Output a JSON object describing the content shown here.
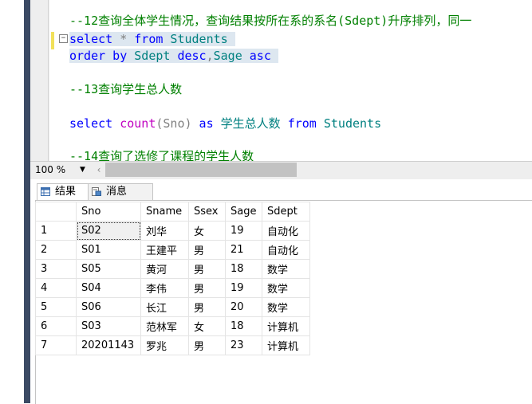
{
  "editor": {
    "line1": "--12查询全体学生情况，查询结果按所在系的系名(Sdept)升序排列，同一",
    "line2_kw1": "select",
    "line2_star": " * ",
    "line2_kw2": "from",
    "line2_id": " Students",
    "line3_kw1": "order by",
    "line3_id": " Sdept ",
    "line3_kw2": "desc",
    "line3_comma": ",",
    "line3_id2": "Sage",
    "line3_kw3": " asc",
    "line4": "--13查询学生总人数",
    "line5_kw1": "select",
    "line5_fn": " count",
    "line5_paren": "(Sno)",
    "line5_kw2": " as",
    "line5_alias": " 学生总人数",
    "line5_kw3": " from",
    "line5_id": " Students",
    "line6": "--14查询了选修了课程的学生人数"
  },
  "zoom": {
    "value": "100 %"
  },
  "tabs": {
    "results": "结果",
    "messages": "消息"
  },
  "grid": {
    "headers": [
      "",
      "Sno",
      "Sname",
      "Ssex",
      "Sage",
      "Sdept"
    ],
    "rows": [
      [
        "1",
        "S02",
        "刘华",
        "女",
        "19",
        "自动化"
      ],
      [
        "2",
        "S01",
        "王建平",
        "男",
        "21",
        "自动化"
      ],
      [
        "3",
        "S05",
        "黄河",
        "男",
        "18",
        "数学"
      ],
      [
        "4",
        "S04",
        "李伟",
        "男",
        "19",
        "数学"
      ],
      [
        "5",
        "S06",
        "长江",
        "男",
        "20",
        "数学"
      ],
      [
        "6",
        "S03",
        "范林军",
        "女",
        "18",
        "计算机"
      ],
      [
        "7",
        "20201143",
        "罗兆",
        "男",
        "23",
        "计算机"
      ]
    ]
  }
}
